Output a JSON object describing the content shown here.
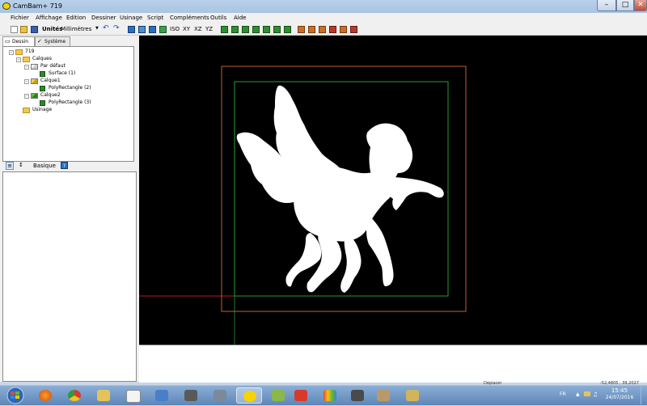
{
  "window": {
    "title": "CamBam+  719"
  },
  "menu": [
    "Fichier",
    "Affichage",
    "Edition",
    "Dessiner",
    "Usinage",
    "Script",
    "Compléments",
    "Outils",
    "Aide"
  ],
  "toolbar": {
    "units_label": "Unités",
    "units_value": "Millimètres",
    "views": [
      "ISO",
      "XY",
      "XZ",
      "YZ"
    ]
  },
  "tabs": {
    "drawing": "Dessin",
    "system": "Système"
  },
  "tree": {
    "root": "719",
    "layers": "Calques",
    "default_layer": "Par défaut",
    "surface": "Surface (1)",
    "layer1": "Calque1",
    "poly2": "PolyRectangle (2)",
    "layer2": "Calque2",
    "poly3": "PolyRectangle (3)",
    "machining": "Usinage"
  },
  "properties": {
    "mode": "Basique",
    "help": "?"
  },
  "status": {
    "left": "Déplacer",
    "coords": "-52,4805 , 39,2027"
  },
  "taskbar": {
    "language": "FR",
    "time": "15:45",
    "date": "24/07/2016"
  },
  "colors": {
    "outer_frame": "#c0603a",
    "inner_frame": "#2c9a38",
    "axis_x": "#c01818",
    "axis_y": "#1e7a2a",
    "silhouette": "#ffffff"
  }
}
